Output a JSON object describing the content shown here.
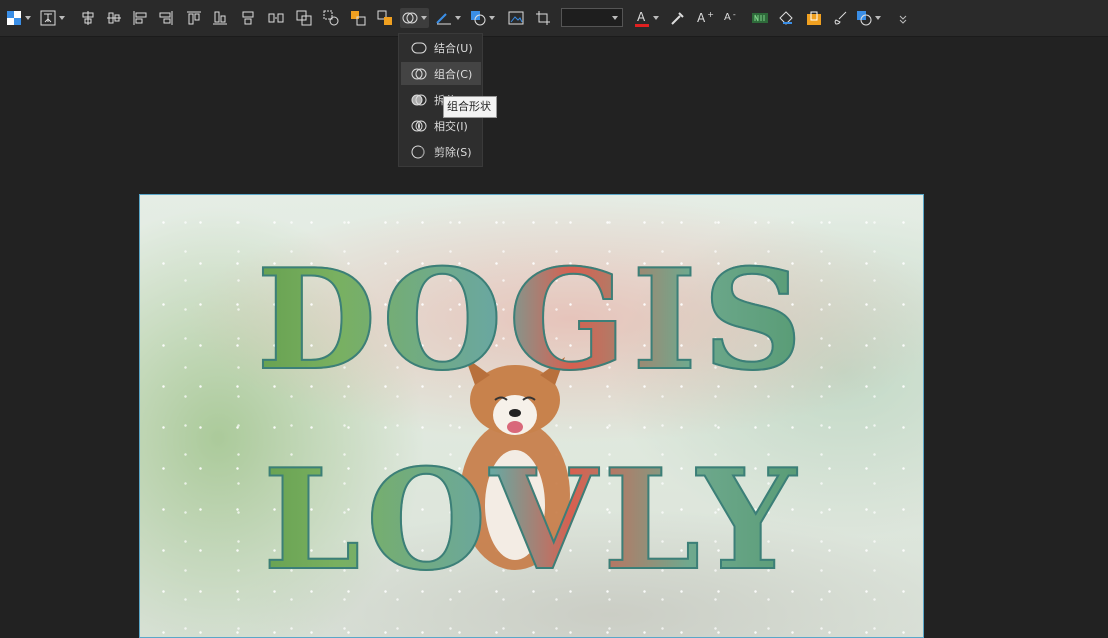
{
  "toolbar": {
    "items": [
      {
        "name": "fill-color-icon",
        "has_caret": true
      },
      {
        "name": "text-wrap-icon",
        "has_caret": true
      },
      {
        "name": "align-center-vertical-icon"
      },
      {
        "name": "align-middle-icon"
      },
      {
        "name": "align-left-icon"
      },
      {
        "name": "align-right-icon"
      },
      {
        "name": "align-top-icon"
      },
      {
        "name": "align-bottom-icon"
      },
      {
        "name": "distribute-horizontal-icon"
      },
      {
        "name": "distribute-vertical-icon"
      },
      {
        "name": "group-icon"
      },
      {
        "name": "ungroup-icon"
      },
      {
        "name": "bring-forward-icon"
      },
      {
        "name": "send-backward-icon"
      },
      {
        "name": "merge-shapes-icon",
        "has_caret": true
      },
      {
        "name": "line-style-icon",
        "has_caret": true
      },
      {
        "name": "shape-fill-icon",
        "has_caret": true
      },
      {
        "name": "picture-icon"
      },
      {
        "name": "crop-icon"
      }
    ],
    "font_size_value": "",
    "text_tools": [
      {
        "name": "font-color-icon",
        "label": "A",
        "accent": "#e02020"
      },
      {
        "name": "eyedropper-icon"
      },
      {
        "name": "increase-font-icon",
        "label": "A"
      },
      {
        "name": "decrease-font-icon",
        "label": "A"
      },
      {
        "name": "text-effect-icon"
      },
      {
        "name": "format-painter-icon"
      },
      {
        "name": "highlight-icon"
      },
      {
        "name": "brush-icon"
      },
      {
        "name": "shape-outline-icon"
      },
      {
        "name": "more-icon"
      }
    ]
  },
  "merge_menu": {
    "items": [
      {
        "label": "结合(U)",
        "icon": "union-icon"
      },
      {
        "label": "组合(C)",
        "icon": "combine-icon",
        "highlighted": true
      },
      {
        "label": "拆分(F)",
        "icon": "fragment-icon"
      },
      {
        "label": "相交(I)",
        "icon": "intersect-icon"
      },
      {
        "label": "剪除(S)",
        "icon": "subtract-icon"
      }
    ],
    "tooltip": "组合形状"
  },
  "slide": {
    "line1": "DOGIS",
    "line2": "LOVLY"
  },
  "colors": {
    "background": "#222222",
    "toolbar": "#2a2a2a",
    "selection_border": "#5aa7c9",
    "icon_blue": "#3a8ee6",
    "icon_orange": "#f0a020"
  }
}
